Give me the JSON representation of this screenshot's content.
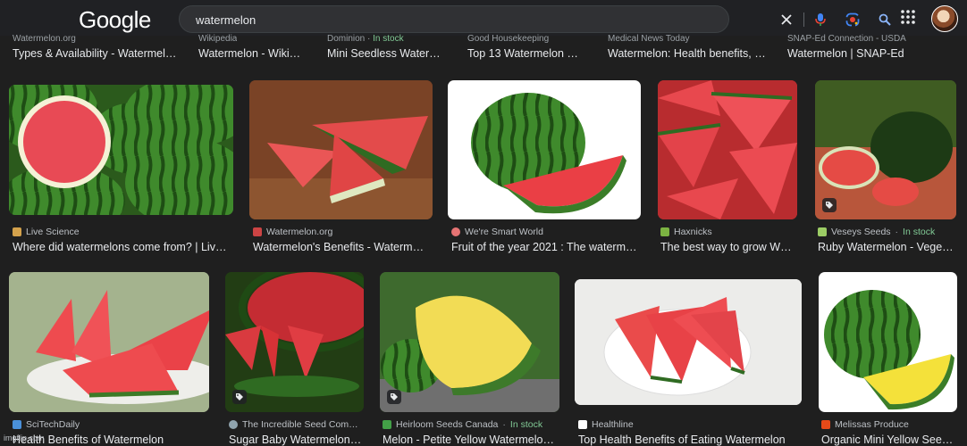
{
  "header": {
    "logo": "Google",
    "search_value": "watermelon"
  },
  "top_row": [
    {
      "source": "Watermelon.org",
      "title": "Types & Availability - Watermel…"
    },
    {
      "source": "Wikipedia",
      "title": "Watermelon - Wiki…"
    },
    {
      "source": "Dominion",
      "stock": "In stock",
      "title": "Mini Seedless Water…"
    },
    {
      "source": "Good Housekeeping",
      "title": "Top 13 Watermelon …"
    },
    {
      "source": "Medical News Today",
      "title": "Watermelon: Health benefits, …"
    },
    {
      "source": "SNAP-Ed Connection - USDA",
      "title": "Watermelon | SNAP-Ed"
    }
  ],
  "row1": [
    {
      "source": "Live Science",
      "title": "Where did watermelons come from? | Liv…"
    },
    {
      "source": "Watermelon.org",
      "title": "Watermelon's Benefits - Waterm…"
    },
    {
      "source": "We're Smart World",
      "title": "Fruit of the year 2021 : The waterm…"
    },
    {
      "source": "Haxnicks",
      "title": "The best way to grow W…"
    },
    {
      "source": "Veseys Seeds",
      "stock": "In stock",
      "title": "Ruby Watermelon - Vege…"
    }
  ],
  "row2": [
    {
      "source": "SciTechDaily",
      "title": "Health Benefits of Watermelon"
    },
    {
      "source": "The Incredible Seed Com…",
      "title": "Sugar Baby Watermelon…"
    },
    {
      "source": "Heirloom Seeds Canada",
      "stock": "In stock",
      "title": "Melon - Petite Yellow Watermelo…"
    },
    {
      "source": "Healthline",
      "title": "Top Health Benefits of Eating Watermelon"
    },
    {
      "source": "Melissas Produce",
      "title": "Organic Mini Yellow See…"
    }
  ],
  "watermark": "imgflip.com",
  "colors": {
    "accent": "#8ab4f8",
    "stock": "#81c995",
    "background": "#1f1f1f"
  }
}
